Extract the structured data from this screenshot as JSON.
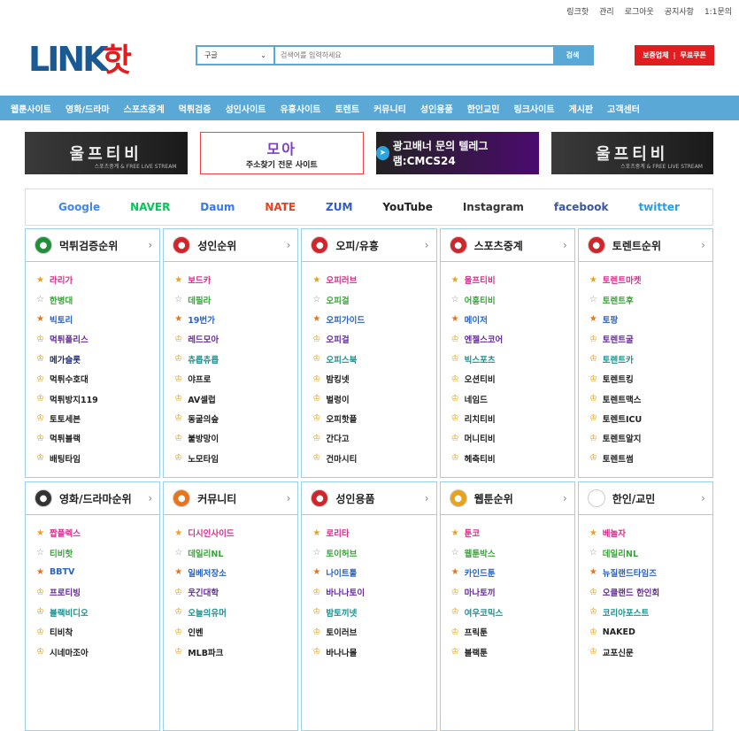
{
  "toplinks": [
    "링크핫",
    "관리",
    "로그아웃",
    "공지사항",
    "1:1문의"
  ],
  "logo": {
    "part1": "LINK",
    "part2": "핫",
    "color1": "#1a5a94",
    "color2": "#e21d20"
  },
  "search": {
    "engine": "구글",
    "placeholder": "검색어를 입력하세요",
    "button": "검색"
  },
  "redbtn": {
    "left": "보증업체",
    "right": "무료쿠폰"
  },
  "nav": [
    "웹툰사이트",
    "영화/드라마",
    "스포츠중계",
    "먹튀검증",
    "성인사이트",
    "유흥사이트",
    "토렌트",
    "커뮤니티",
    "성인용품",
    "한인교민",
    "링크사이트",
    "게시판",
    "고객센터"
  ],
  "banners": {
    "b1": {
      "title": "울프티비",
      "sub": "스포츠중계 & FREE LIVE STREAM"
    },
    "b2": {
      "top": "모아",
      "bottom": "주소찾기 전문 사이트"
    },
    "b3": {
      "text": "광고배너 문의 텔레그램:CMCS24"
    },
    "b4": {
      "title": "울프티비",
      "sub": "스포츠중계 & FREE LIVE STREAM"
    }
  },
  "searchlogos": [
    {
      "name": "Google",
      "color": "#4285f4"
    },
    {
      "name": "NAVER",
      "color": "#03c75a"
    },
    {
      "name": "Daum",
      "color": "#3478f6"
    },
    {
      "name": "NATE",
      "color": "#e8401c"
    },
    {
      "name": "ZUM",
      "color": "#2b5bd7"
    },
    {
      "name": "YouTube",
      "color": "#222222"
    },
    {
      "name": "Instagram",
      "color": "#333333"
    },
    {
      "name": "facebook",
      "color": "#3b5998"
    },
    {
      "name": "twitter",
      "color": "#1da1f2"
    }
  ],
  "cards": [
    {
      "title": "먹튀검증순위",
      "iconColor": "#1f8f3a",
      "items": [
        {
          "t": "라리가",
          "c": "#d62f8c"
        },
        {
          "t": "한병대",
          "c": "#3aa43a"
        },
        {
          "t": "빅토리",
          "c": "#2a63c2"
        },
        {
          "t": "먹튀폴리스",
          "c": "#6a2a9e"
        },
        {
          "t": "메가슬롯",
          "c": "#1f2f7a"
        },
        {
          "t": "먹튀수호대",
          "c": "#222222"
        },
        {
          "t": "먹튀방지119",
          "c": "#222222"
        },
        {
          "t": "토토세븐",
          "c": "#222222"
        },
        {
          "t": "먹튀블랙",
          "c": "#222222"
        },
        {
          "t": "배팅타임",
          "c": "#222222"
        }
      ]
    },
    {
      "title": "성인순위",
      "iconColor": "#d0252a",
      "items": [
        {
          "t": "보드카",
          "c": "#d62f8c"
        },
        {
          "t": "데필라",
          "c": "#3aa43a"
        },
        {
          "t": "19번가",
          "c": "#2a63c2"
        },
        {
          "t": "레드모아",
          "c": "#6a2a9e"
        },
        {
          "t": "츄릅츄릅",
          "c": "#1f8f8f"
        },
        {
          "t": "야프로",
          "c": "#222222"
        },
        {
          "t": "AV셀럽",
          "c": "#222222"
        },
        {
          "t": "동굴의숲",
          "c": "#222222"
        },
        {
          "t": "불방망이",
          "c": "#222222"
        },
        {
          "t": "노모타임",
          "c": "#222222"
        }
      ]
    },
    {
      "title": "오피/유흥",
      "iconColor": "#d0252a",
      "items": [
        {
          "t": "오피러브",
          "c": "#d62f8c"
        },
        {
          "t": "오피걸",
          "c": "#3aa43a"
        },
        {
          "t": "오피가이드",
          "c": "#2a63c2"
        },
        {
          "t": "오피걸",
          "c": "#6a2a9e"
        },
        {
          "t": "오피스북",
          "c": "#1f8f8f"
        },
        {
          "t": "밤킹넷",
          "c": "#222222"
        },
        {
          "t": "벌렁이",
          "c": "#222222"
        },
        {
          "t": "오피핫플",
          "c": "#222222"
        },
        {
          "t": "간다고",
          "c": "#222222"
        },
        {
          "t": "건마시티",
          "c": "#222222"
        }
      ]
    },
    {
      "title": "스포츠중계",
      "iconColor": "#d0252a",
      "items": [
        {
          "t": "울프티비",
          "c": "#d62f8c"
        },
        {
          "t": "어흥티비",
          "c": "#3aa43a"
        },
        {
          "t": "메이저",
          "c": "#2a63c2"
        },
        {
          "t": "엔젤스코어",
          "c": "#6a2a9e"
        },
        {
          "t": "빅스포츠",
          "c": "#1f8f8f"
        },
        {
          "t": "오션티비",
          "c": "#222222"
        },
        {
          "t": "네임드",
          "c": "#222222"
        },
        {
          "t": "리치티비",
          "c": "#222222"
        },
        {
          "t": "머니티비",
          "c": "#222222"
        },
        {
          "t": "헤축티비",
          "c": "#222222"
        }
      ]
    },
    {
      "title": "토렌트순위",
      "iconColor": "#d0252a",
      "items": [
        {
          "t": "토렌트마켓",
          "c": "#d62f8c"
        },
        {
          "t": "토렌트후",
          "c": "#3aa43a"
        },
        {
          "t": "토팡",
          "c": "#2a63c2"
        },
        {
          "t": "토렌트굴",
          "c": "#6a2a9e"
        },
        {
          "t": "토렌트카",
          "c": "#1f8f8f"
        },
        {
          "t": "토렌트킹",
          "c": "#222222"
        },
        {
          "t": "토렌트맥스",
          "c": "#222222"
        },
        {
          "t": "토렌트ICU",
          "c": "#222222"
        },
        {
          "t": "토렌트알지",
          "c": "#222222"
        },
        {
          "t": "토렌트썸",
          "c": "#222222"
        }
      ]
    },
    {
      "title": "영화/드라마순위",
      "iconColor": "#333333",
      "items": [
        {
          "t": "짭플렉스",
          "c": "#d62f8c"
        },
        {
          "t": "티비핫",
          "c": "#3aa43a"
        },
        {
          "t": "BBTV",
          "c": "#2a63c2"
        },
        {
          "t": "프로티빙",
          "c": "#6a2a9e"
        },
        {
          "t": "블랙비디오",
          "c": "#1f8f8f"
        },
        {
          "t": "티비착",
          "c": "#222222"
        },
        {
          "t": "시네마조아",
          "c": "#222222"
        }
      ]
    },
    {
      "title": "커뮤니티",
      "iconColor": "#e8741c",
      "items": [
        {
          "t": "디시인사이드",
          "c": "#d62f8c"
        },
        {
          "t": "데일리NL",
          "c": "#3aa43a"
        },
        {
          "t": "일베저장소",
          "c": "#2a63c2"
        },
        {
          "t": "웃긴대학",
          "c": "#6a2a9e"
        },
        {
          "t": "오늘의유머",
          "c": "#1f8f8f"
        },
        {
          "t": "인벤",
          "c": "#222222"
        },
        {
          "t": "MLB파크",
          "c": "#222222"
        }
      ]
    },
    {
      "title": "성인용품",
      "iconColor": "#d0252a",
      "items": [
        {
          "t": "로리타",
          "c": "#d62f8c"
        },
        {
          "t": "토이허브",
          "c": "#3aa43a"
        },
        {
          "t": "나이트툴",
          "c": "#2a63c2"
        },
        {
          "t": "바나나토이",
          "c": "#6a2a9e"
        },
        {
          "t": "밤토끼넷",
          "c": "#1f8f8f"
        },
        {
          "t": "토이러브",
          "c": "#222222"
        },
        {
          "t": "바나나몰",
          "c": "#222222"
        }
      ]
    },
    {
      "title": "웹툰순위",
      "iconColor": "#e8a21c",
      "items": [
        {
          "t": "툰코",
          "c": "#d62f8c"
        },
        {
          "t": "웹툰박스",
          "c": "#3aa43a"
        },
        {
          "t": "카인드툰",
          "c": "#2a63c2"
        },
        {
          "t": "마나토끼",
          "c": "#6a2a9e"
        },
        {
          "t": "여우코믹스",
          "c": "#1f8f8f"
        },
        {
          "t": "프릭툰",
          "c": "#222222"
        },
        {
          "t": "블랙툰",
          "c": "#222222"
        }
      ]
    },
    {
      "title": "한인/교민",
      "iconColor": "#ffffff",
      "items": [
        {
          "t": "베놀자",
          "c": "#d62f8c"
        },
        {
          "t": "데일리NL",
          "c": "#3aa43a"
        },
        {
          "t": "뉴질랜드타임즈",
          "c": "#2a63c2"
        },
        {
          "t": "오클랜드 한인회",
          "c": "#6a2a9e"
        },
        {
          "t": "코리아포스트",
          "c": "#1f8f8f"
        },
        {
          "t": "NAKED",
          "c": "#222222"
        },
        {
          "t": "교포신문",
          "c": "#222222"
        }
      ]
    }
  ],
  "rankIcons": [
    "★",
    "☆",
    "★",
    "♔",
    "♔",
    "♔",
    "♔",
    "♔",
    "♔",
    "♔"
  ],
  "rankColors": [
    "#e8a21c",
    "#999999",
    "#e8741c",
    "#e8a21c",
    "#e8a21c",
    "#e8a21c",
    "#e8a21c",
    "#e8a21c",
    "#e8a21c",
    "#e8a21c"
  ]
}
